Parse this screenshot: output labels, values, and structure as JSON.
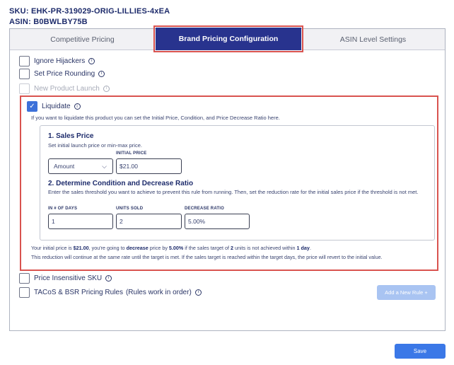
{
  "product": {
    "sku_label": "SKU:",
    "sku": "EHK-PR-319029-ORIG-LILLIES-4xEA",
    "asin_label": "ASIN:",
    "asin": "B0BWLBY75B"
  },
  "tabs": [
    {
      "label": "Competitive Pricing",
      "active": false
    },
    {
      "label": "Brand Pricing Configuration",
      "active": true
    },
    {
      "label": "ASIN Level Settings",
      "active": false
    }
  ],
  "options": {
    "ignore_hijackers": "Ignore Hijackers",
    "set_price_rounding": "Set Price Rounding",
    "new_product_launch": "New Product Launch",
    "price_insensitive": "Price Insensitive SKU",
    "tacos_bsr": "TACoS & BSR Pricing Rules",
    "tacos_bsr_note": "(Rules work in order)"
  },
  "liquidate": {
    "label": "Liquidate",
    "checked": true,
    "description": "If you want to liquidate this product you can set the Initial Price, Condition, and Price Decrease Ratio here.",
    "sales_price": {
      "title": "1. Sales Price",
      "subtitle": "Set initial launch price or min-max price.",
      "type_selected": "Amount",
      "initial_price_label": "INITIAL PRICE",
      "initial_price": "$21.00"
    },
    "condition": {
      "title": "2. Determine Condition and Decrease Ratio",
      "subtitle": "Enter the sales threshold you want to achieve to prevent this rule from running. Then, set the reduction rate for the initial sales price if the threshold is not met.",
      "days_label": "IN # OF DAYS",
      "days": "1",
      "units_label": "UNITS SOLD",
      "units": "2",
      "ratio_label": "DECREASE RATIO",
      "ratio": "5.00%"
    },
    "summary": {
      "p1": "Your initial price is ",
      "price": "$21.00",
      "p2": ", you're going to ",
      "action": "decrease",
      "p3": " price by ",
      "ratio": "5.00%",
      "p4": " if the sales target of ",
      "units": "2",
      "p5": " units is not achieved within ",
      "days": "1 day",
      "p6": ".",
      "line2": "This reduction will continue at the same rate until the target is met. If the sales target is reached within the target days, the price will revert to the initial value."
    }
  },
  "buttons": {
    "add_rule": "Add a New Rule +",
    "save": "Save"
  },
  "icons": {
    "info": "info-icon",
    "check": "check-icon",
    "chevron": "chevron-down-icon"
  },
  "colors": {
    "primary": "#28338e",
    "highlight": "#d9534f",
    "checkbox_checked": "#3d71d9",
    "save_button": "#3b78e7",
    "add_rule_disabled": "#a9c4f2"
  }
}
